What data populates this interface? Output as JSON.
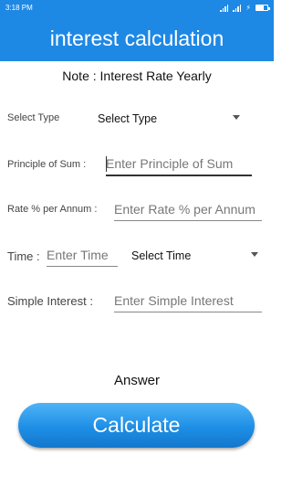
{
  "status_bar": {
    "time": "3:18 PM"
  },
  "app": {
    "title": "interest calculation"
  },
  "note": "Note : Interest Rate Yearly",
  "form": {
    "select_type": {
      "label": "Select Type",
      "value": "Select Type"
    },
    "principle": {
      "label": "Principle of Sum :",
      "placeholder": "Enter Principle of Sum"
    },
    "rate": {
      "label": "Rate % per Annum :",
      "placeholder": "Enter Rate % per Annum"
    },
    "time": {
      "label": "Time :",
      "placeholder": "Enter Time",
      "unit_value": "Select Time"
    },
    "simple_interest": {
      "label": "Simple Interest :",
      "placeholder": "Enter Simple Interest"
    }
  },
  "answer_label": "Answer",
  "calculate_label": "Calculate",
  "colors": {
    "primary": "#1e88e5"
  }
}
